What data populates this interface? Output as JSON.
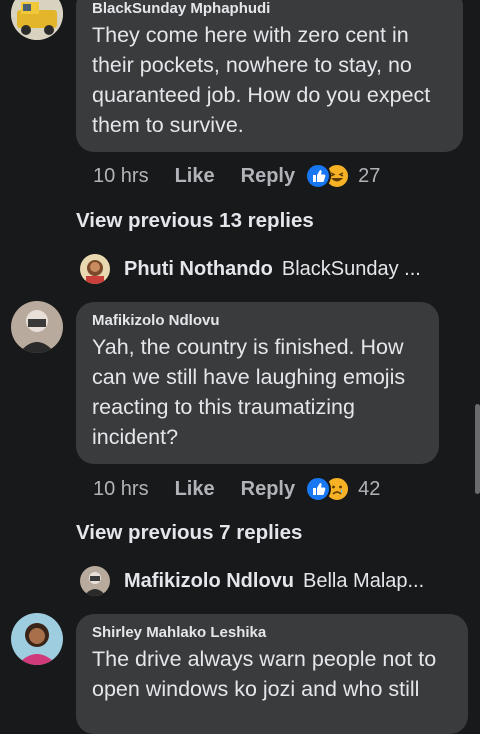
{
  "comments": [
    {
      "author": "BlackSunday Mphaphudi",
      "text": "They come here with zero cent in their pockets, nowhere to stay, no quaranteed job. How do you expect them to survive.",
      "time": "10 hrs",
      "like_label": "Like",
      "reply_label": "Reply",
      "reaction_count": "27",
      "reactions": [
        "like-icon",
        "laughing-emoji-icon"
      ],
      "view_previous": "View previous 13 replies",
      "latest_reply": {
        "name": "Phuti Nothando",
        "snippet": "BlackSunday ..."
      }
    },
    {
      "author": "Mafikizolo Ndlovu",
      "text": "Yah, the country is finished. How can we still have laughing emojis reacting to this traumatizing incident?",
      "time": "10 hrs",
      "like_label": "Like",
      "reply_label": "Reply",
      "reaction_count": "42",
      "reactions": [
        "like-icon",
        "sad-emoji-icon"
      ],
      "view_previous": "View previous 7 replies",
      "latest_reply": {
        "name": "Mafikizolo Ndlovu",
        "snippet": "Bella Malap..."
      }
    },
    {
      "author": "Shirley Mahlako Leshika",
      "text": "The drive always warn people not to open windows ko jozi and who still"
    }
  ],
  "colors": {
    "background": "#18191a",
    "bubble": "#3a3b3c",
    "primary_text": "#e4e6eb",
    "secondary_text": "#b0b3b8",
    "like_blue": "#1877f2",
    "emoji_yellow": "#f7b125"
  }
}
